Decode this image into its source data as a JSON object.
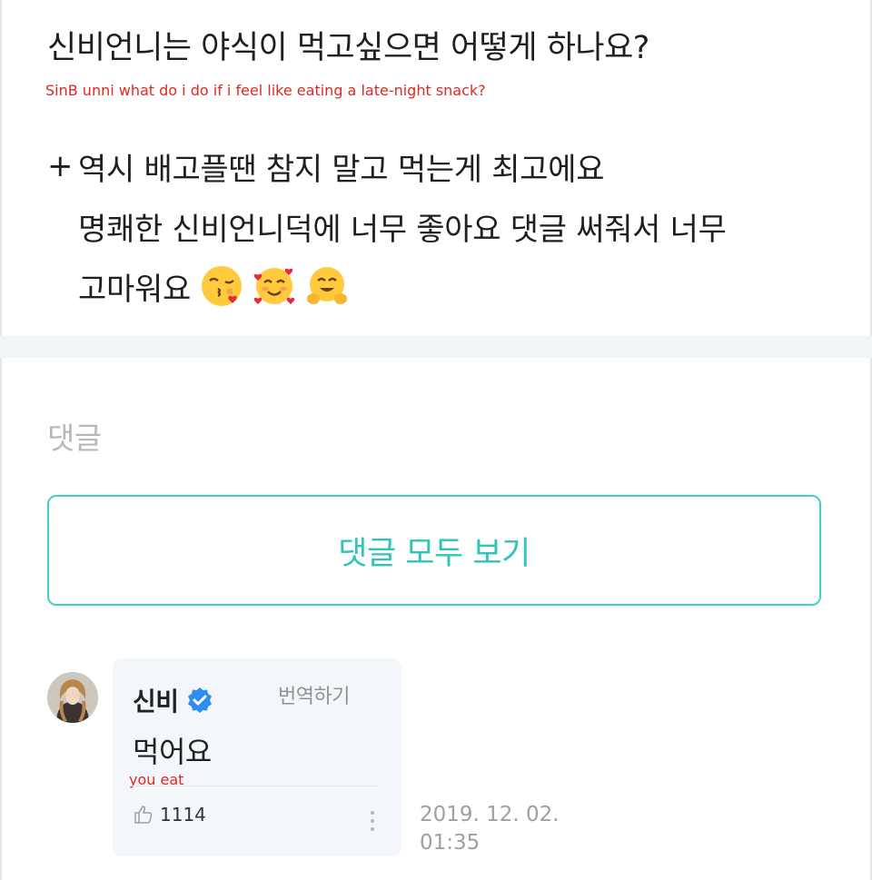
{
  "post": {
    "question": "신비언니는 야식이 먹고싶으면 어떻게 하나요?",
    "question_translation": "SinB unni what do i do if i feel like eating a late-night snack?",
    "answer_prefix": "+",
    "answer_lines": [
      "역시 배고플땐 참지 말고 먹는게 최고에요",
      "명쾌한 신비언니덕에 너무 좋아요 댓글 써줘서 너무",
      "고마워요"
    ],
    "emojis": [
      "face-blowing-kiss-icon",
      "smiling-face-with-hearts-icon",
      "hugging-face-icon"
    ]
  },
  "comments": {
    "heading": "댓글",
    "view_all_label": "댓글 모두 보기"
  },
  "comment": {
    "author": "신비",
    "verified_icon": "verified-badge-icon",
    "translate_label": "번역하기",
    "text": "먹어요",
    "translation": "you eat",
    "likes": "1114",
    "timestamp_date": "2019. 12. 02.",
    "timestamp_time": "01:35"
  },
  "colors": {
    "accent": "#2fc4b8",
    "verified": "#2f8cf0",
    "translation_overlay": "#e0281f"
  }
}
